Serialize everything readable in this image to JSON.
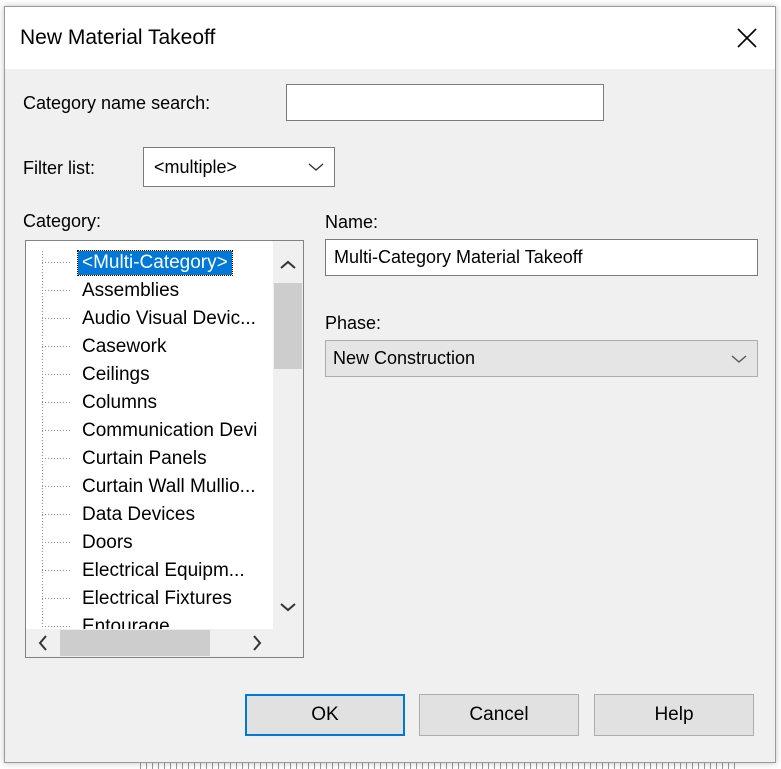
{
  "dialog": {
    "title": "New Material Takeoff"
  },
  "search": {
    "label": "Category name search:",
    "value": ""
  },
  "filter": {
    "label": "Filter list:",
    "value": "<multiple>"
  },
  "category": {
    "label": "Category:",
    "items": [
      "<Multi-Category>",
      "Assemblies",
      "Audio Visual Devic...",
      "Casework",
      "Ceilings",
      "Columns",
      "Communication Devi",
      "Curtain Panels",
      "Curtain Wall Mullio...",
      "Data Devices",
      "Doors",
      "Electrical Equipm...",
      "Electrical Fixtures",
      "Entourage"
    ],
    "selected_index": 0
  },
  "name": {
    "label": "Name:",
    "value": "Multi-Category Material Takeoff"
  },
  "phase": {
    "label": "Phase:",
    "value": "New Construction"
  },
  "buttons": {
    "ok": "OK",
    "cancel": "Cancel",
    "help": "Help"
  },
  "colors": {
    "accent": "#0078d7",
    "dialog_bg": "#f0f0f0"
  },
  "icons": {
    "close": "close-icon",
    "dropdown": "chevron-down-icon",
    "scroll_up": "chevron-up-icon",
    "scroll_down": "chevron-down-icon",
    "scroll_left": "chevron-left-icon",
    "scroll_right": "chevron-right-icon"
  }
}
